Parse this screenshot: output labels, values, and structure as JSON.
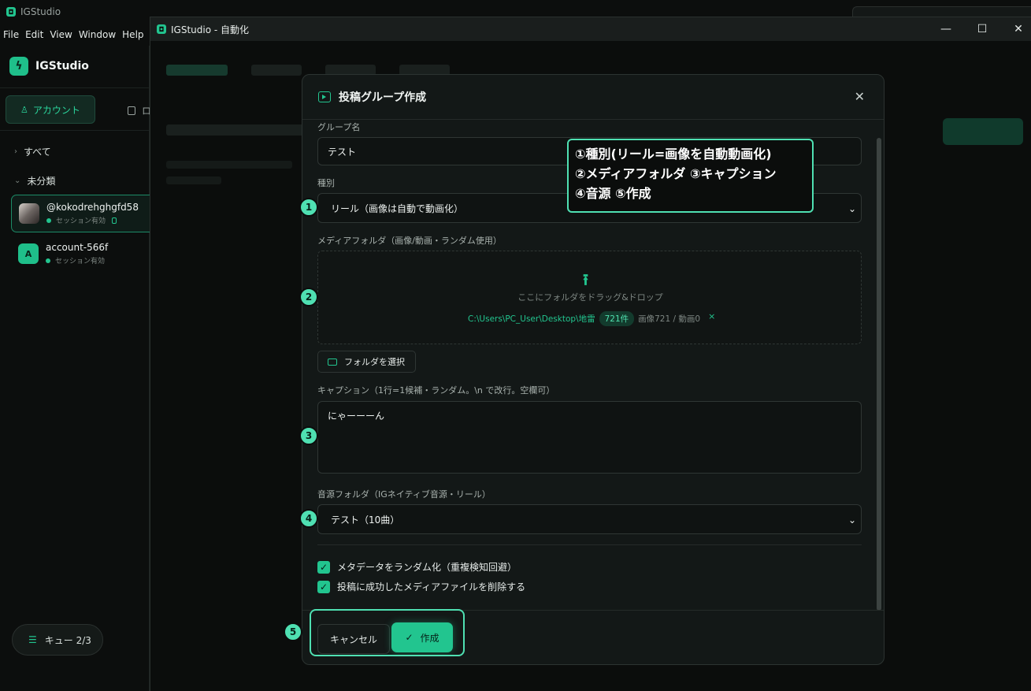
{
  "main_window": {
    "title": "IGStudio",
    "menu": [
      "File",
      "Edit",
      "View",
      "Window",
      "Help"
    ]
  },
  "sidebar": {
    "brand": "IGStudio",
    "tab_account": "アカウント",
    "tab_second_initial": "ロ",
    "tree_all": "すべて",
    "tree_uncategorized": "未分類",
    "accounts": [
      {
        "name": "@kokodrehghgfd58",
        "status": "セッション有効",
        "active": true
      },
      {
        "name": "account-566f",
        "status": "セッション有効",
        "initial": "A",
        "active": false
      }
    ],
    "queue_label": "キュー 2/3"
  },
  "automation_window": {
    "title": "IGStudio - 自動化"
  },
  "modal": {
    "title": "投稿グループ作成",
    "group_name_label": "グループ名",
    "group_name_value": "テスト",
    "type_label": "種別",
    "type_value": "リール（画像は自動で動画化）",
    "media_label": "メディアフォルダ（画像/動画・ランダム使用）",
    "dropzone_hint": "ここにフォルダをドラッグ&ドロップ",
    "folder_path": "C:\\Users\\PC_User\\Desktop\\地雷",
    "folder_count": "721件",
    "folder_stats": "画像721 / 動画0",
    "select_folder_button": "フォルダを選択",
    "caption_label": "キャプション（1行=1候補・ランダム。\\n で改行。空欄可）",
    "caption_value": "にゃーーーん",
    "audio_label": "音源フォルダ（IGネイティブ音源・リール）",
    "audio_value": "テスト（10曲）",
    "checkbox_randomize": "メタデータをランダム化（重複検知回避）",
    "checkbox_delete": "投稿に成功したメディアファイルを削除する",
    "cancel_button": "キャンセル",
    "create_button": "作成"
  },
  "annotations": {
    "badges": [
      "1",
      "2",
      "3",
      "4",
      "5"
    ],
    "callout_lines": [
      "①種別(リール=画像を自動動画化)",
      "②メディアフォルダ ③キャプション",
      "④音源 ⑤作成"
    ]
  },
  "colors": {
    "accent": "#22c58f",
    "annotation": "#4fe0b2",
    "background": "#0b0d0c"
  }
}
